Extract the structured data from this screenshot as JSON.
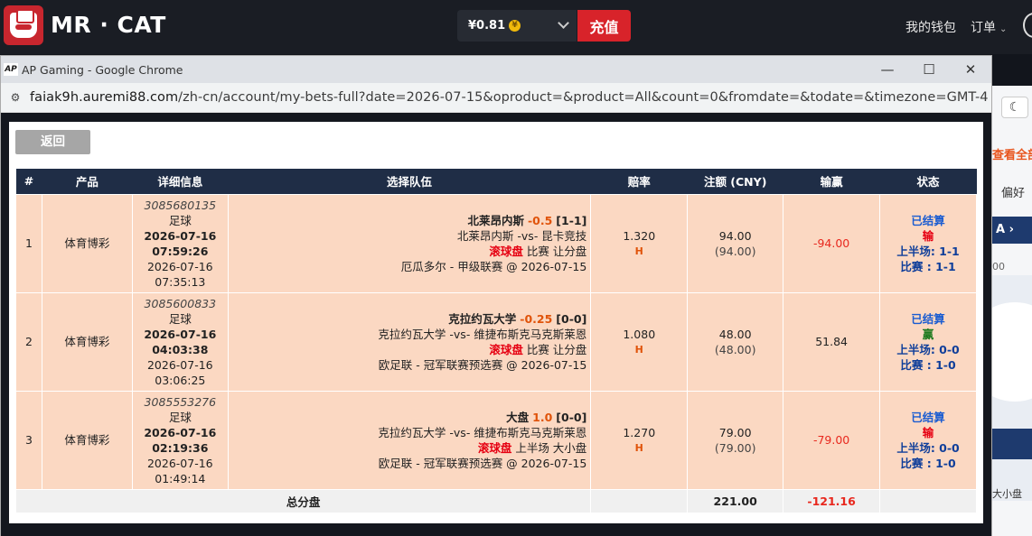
{
  "site": {
    "brand": "MR · CAT",
    "balance": "¥0.81",
    "coin_symbol": "¥",
    "recharge": "充值",
    "wallet": "我的钱包",
    "orders": "订单",
    "orders_caret": "⌄"
  },
  "side": {
    "view_all": "查看全部",
    "preferences": "偏好",
    "nav_label": "A ›",
    "zero": "00",
    "small_label": "大小盘"
  },
  "window": {
    "app_icon_label": "AP",
    "title": "AP Gaming - Google Chrome",
    "minimize": "—",
    "maximize": "☐",
    "close": "✕",
    "url_host": "faiak9h.auremi88.com",
    "url_path": "/zh-cn/account/my-bets-full?date=2026-07-15&oproduct=&product=All&count=0&fromdate=&todate=&timezone=GMT-4"
  },
  "page": {
    "back_button": "返回",
    "columns": [
      "#",
      "产品",
      "详细信息",
      "选择队伍",
      "赔率",
      "注额 (CNY)",
      "输赢",
      "状态"
    ],
    "bets": [
      {
        "index": "1",
        "product": "体育博彩",
        "ticket": "3085680135",
        "sport": "足球",
        "placed_date": "2026-07-16",
        "placed_time": "07:59:26",
        "event_date": "2026-07-16",
        "event_time": "07:35:13",
        "pick_team": "北莱昂内斯",
        "pick_handicap": "-0.5",
        "pick_score": "[1-1]",
        "match": "北莱昂内斯 -vs- 昆卡竞技",
        "bet_live": "滚球盘",
        "bet_type": "比赛 让分盘",
        "league": "厄瓜多尔 - 甲级联赛 @ 2026-07-15",
        "odds": "1.320",
        "odds_type": "H",
        "stake": "94.00",
        "stake_paren": "(94.00)",
        "winloss": "-94.00",
        "status": "已结算",
        "result": "输",
        "half": "上半场: 1-1",
        "full": "比赛 : 1-1"
      },
      {
        "index": "2",
        "product": "体育博彩",
        "ticket": "3085600833",
        "sport": "足球",
        "placed_date": "2026-07-16",
        "placed_time": "04:03:38",
        "event_date": "2026-07-16",
        "event_time": "03:06:25",
        "pick_team": "克拉约瓦大学",
        "pick_handicap": "-0.25",
        "pick_score": "[0-0]",
        "match": "克拉约瓦大学 -vs- 维捷布斯克马克斯莱恩",
        "bet_live": "滚球盘",
        "bet_type": "比赛 让分盘",
        "league": "欧足联 - 冠军联赛预选赛 @ 2026-07-15",
        "odds": "1.080",
        "odds_type": "H",
        "stake": "48.00",
        "stake_paren": "(48.00)",
        "winloss": "51.84",
        "status": "已结算",
        "result": "赢",
        "half": "上半场: 0-0",
        "full": "比赛 : 1-0"
      },
      {
        "index": "3",
        "product": "体育博彩",
        "ticket": "3085553276",
        "sport": "足球",
        "placed_date": "2026-07-16",
        "placed_time": "02:19:36",
        "event_date": "2026-07-16",
        "event_time": "01:49:14",
        "pick_team": "大盘",
        "pick_handicap": "1.0",
        "pick_score": "[0-0]",
        "match": "克拉约瓦大学 -vs- 维捷布斯克马克斯莱恩",
        "bet_live": "滚球盘",
        "bet_type": "上半场 大小盘",
        "league": "欧足联 - 冠军联赛预选赛 @ 2026-07-15",
        "odds": "1.270",
        "odds_type": "H",
        "stake": "79.00",
        "stake_paren": "(79.00)",
        "winloss": "-79.00",
        "status": "已结算",
        "result": "输",
        "half": "上半场: 0-0",
        "full": "比赛 : 1-0"
      }
    ],
    "total_label": "总分盘",
    "total_stake": "221.00",
    "total_winloss": "-121.16"
  }
}
